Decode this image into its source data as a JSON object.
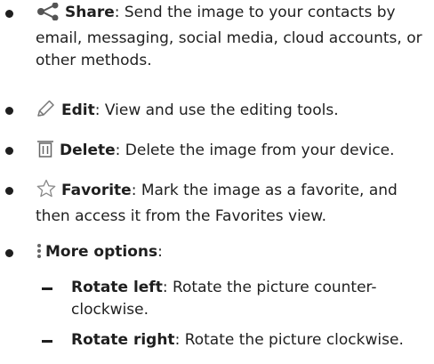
{
  "items": [
    {
      "icon": "share-icon",
      "term": "Share",
      "desc": ": Send the image to your contacts by email, messaging, social media, cloud accounts, or other methods."
    },
    {
      "icon": "pencil-icon",
      "term": "Edit",
      "desc": ": View and use the editing tools."
    },
    {
      "icon": "trash-icon",
      "term": "Delete",
      "desc": ": Delete the image from your device."
    },
    {
      "icon": "star-icon",
      "term": "Favorite",
      "desc": ": Mark the image as a favorite, and then access it from the Favorites view."
    },
    {
      "icon": "more-options-icon",
      "term": "More options",
      "desc": ":"
    }
  ],
  "subitems": [
    {
      "term": "Rotate left",
      "desc": ": Rotate the picture counter-clockwise."
    },
    {
      "term": "Rotate right",
      "desc": ": Rotate the picture clockwise."
    }
  ]
}
